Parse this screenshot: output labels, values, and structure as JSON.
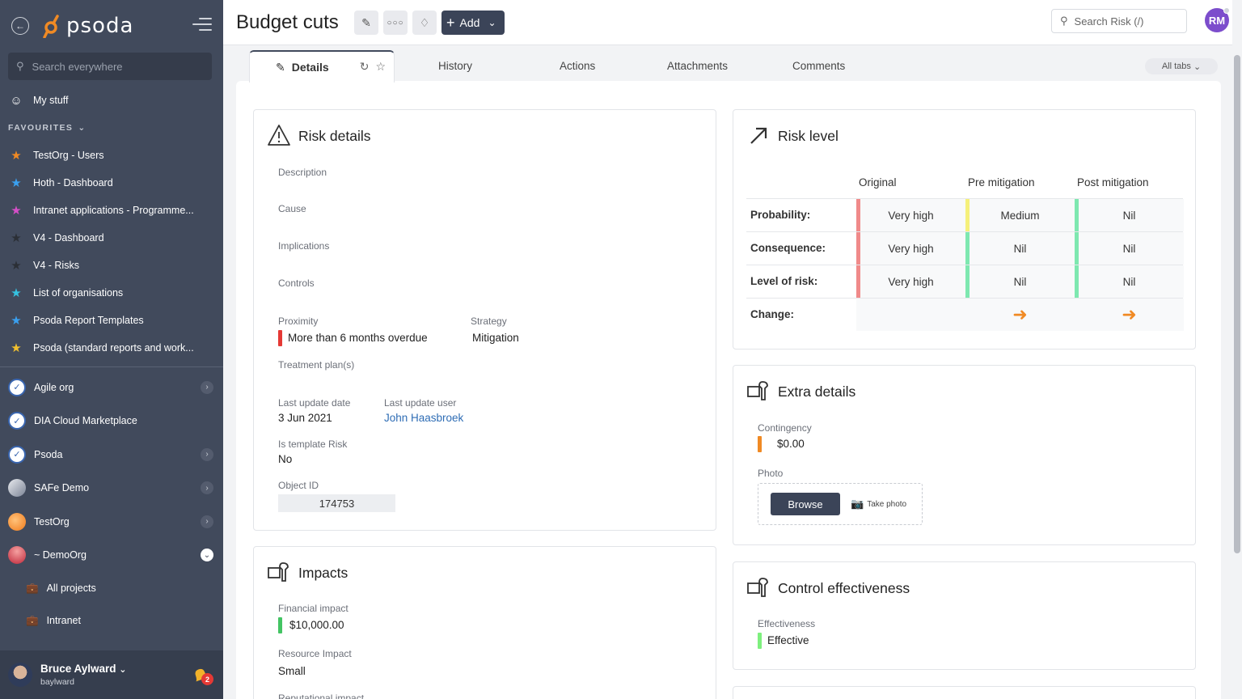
{
  "sidebar": {
    "logo_text": "psoda",
    "search_placeholder": "Search everywhere",
    "my_stuff": "My stuff",
    "favourites_label": "FAVOURITES",
    "favourites": [
      {
        "label": "TestOrg - Users",
        "color": "#f08a24"
      },
      {
        "label": "Hoth - Dashboard",
        "color": "#3aa0f0"
      },
      {
        "label": "Intranet applications - Programme...",
        "color": "#d64fc8"
      },
      {
        "label": "V4 - Dashboard",
        "color": "#2b2f36"
      },
      {
        "label": "V4 - Risks",
        "color": "#2b2f36"
      },
      {
        "label": "List of organisations",
        "color": "#35c2e0"
      },
      {
        "label": "Psoda Report Templates",
        "color": "#3aa0f0"
      },
      {
        "label": "Psoda (standard reports and work...",
        "color": "#f2c12e"
      }
    ],
    "orgs": [
      {
        "label": "Agile org"
      },
      {
        "label": "DIA Cloud Marketplace"
      },
      {
        "label": "Psoda"
      },
      {
        "label": "SAFe Demo"
      },
      {
        "label": "TestOrg"
      },
      {
        "label": "~ DemoOrg"
      }
    ],
    "sub_items": [
      {
        "label": "All projects"
      },
      {
        "label": "Intranet"
      }
    ],
    "user": {
      "name": "Bruce Aylward",
      "login": "baylward",
      "notifications": "2"
    }
  },
  "header": {
    "title": "Budget cuts",
    "add_label": "Add",
    "search_placeholder": "Search Risk (/)",
    "avatar_initials": "RM"
  },
  "tabs": {
    "active": "Details",
    "items": [
      "History",
      "Actions",
      "Attachments",
      "Comments"
    ],
    "all_tabs": "All tabs"
  },
  "risk_details": {
    "title": "Risk details",
    "description_label": "Description",
    "cause_label": "Cause",
    "implications_label": "Implications",
    "controls_label": "Controls",
    "proximity_label": "Proximity",
    "proximity_value": "More than 6 months overdue",
    "strategy_label": "Strategy",
    "strategy_value": "Mitigation",
    "treatment_label": "Treatment plan(s)",
    "last_update_date_label": "Last update date",
    "last_update_date_value": "3 Jun 2021",
    "last_update_user_label": "Last update user",
    "last_update_user_value": "John Haasbroek",
    "is_template_label": "Is template Risk",
    "is_template_value": "No",
    "object_id_label": "Object ID",
    "object_id_value": "174753"
  },
  "risk_level": {
    "title": "Risk level",
    "columns": [
      "Original",
      "Pre mitigation",
      "Post mitigation"
    ],
    "rows": [
      {
        "label": "Probability:",
        "values": [
          "Very high",
          "Medium",
          "Nil"
        ],
        "colors": [
          "#f08a8a",
          "#f5f07a",
          "#7ee8b0"
        ]
      },
      {
        "label": "Consequence:",
        "values": [
          "Very high",
          "Nil",
          "Nil"
        ],
        "colors": [
          "#f08a8a",
          "#7ee8b0",
          "#7ee8b0"
        ]
      },
      {
        "label": "Level of risk:",
        "values": [
          "Very high",
          "Nil",
          "Nil"
        ],
        "colors": [
          "#f08a8a",
          "#7ee8b0",
          "#7ee8b0"
        ]
      }
    ],
    "change_label": "Change:"
  },
  "extra_details": {
    "title": "Extra details",
    "contingency_label": "Contingency",
    "contingency_value": "$0.00",
    "photo_label": "Photo",
    "browse_label": "Browse",
    "take_photo_label": "Take photo"
  },
  "impacts": {
    "title": "Impacts",
    "financial_label": "Financial impact",
    "financial_value": "$10,000.00",
    "resource_label": "Resource Impact",
    "resource_value": "Small",
    "reputational_label": "Reputational impact"
  },
  "control_effectiveness": {
    "title": "Control effectiveness",
    "effectiveness_label": "Effectiveness",
    "effectiveness_value": "Effective"
  }
}
